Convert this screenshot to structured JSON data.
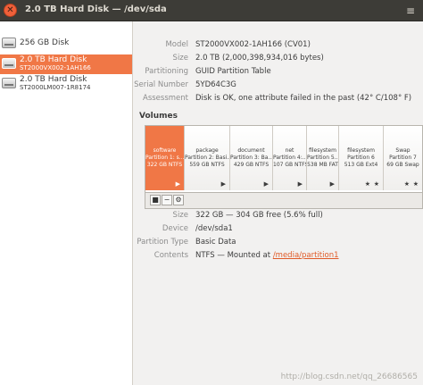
{
  "window": {
    "title": "2.0 TB Hard Disk — /dev/sda",
    "close_glyph": "✕",
    "menu_glyph": "≡"
  },
  "sidebar": {
    "disks": [
      {
        "name": "256 GB Disk",
        "model": ""
      },
      {
        "name": "2.0 TB Hard Disk",
        "model": "ST2000VX002-1AH166"
      },
      {
        "name": "2.0 TB Hard Disk",
        "model": "ST2000LM007-1R8174"
      }
    ]
  },
  "disk_info": {
    "model": {
      "label": "Model",
      "value": "ST2000VX002-1AH166 (CV01)"
    },
    "size": {
      "label": "Size",
      "value": "2.0 TB (2,000,398,934,016 bytes)"
    },
    "partitioning": {
      "label": "Partitioning",
      "value": "GUID Partition Table"
    },
    "serial": {
      "label": "Serial Number",
      "value": "5YD64C3G"
    },
    "assessment": {
      "label": "Assessment",
      "value": "Disk is OK, one attribute failed in the past (42° C/108° F)"
    }
  },
  "volumes": {
    "title": "Volumes",
    "partitions": [
      {
        "name": "software",
        "num": "Partition 1: s...",
        "size": "322 GB NTFS",
        "icon": "▶"
      },
      {
        "name": "package",
        "num": "Partition 2: Basi...",
        "size": "559 GB NTFS",
        "icon": "▶"
      },
      {
        "name": "document",
        "num": "Partition 3: Ba...",
        "size": "429 GB NTFS",
        "icon": "▶"
      },
      {
        "name": "net",
        "num": "Partition 4:...",
        "size": "107 GB NTFS",
        "icon": "▶"
      },
      {
        "name": "filesystem",
        "num": "Partition 5...",
        "size": "538 MB FAT",
        "icon": "▶"
      },
      {
        "name": "filesystem",
        "num": "Partition 6",
        "size": "513 GB Ext4",
        "icon": "★",
        "icon2": "★"
      },
      {
        "name": "Swap",
        "num": "Partition 7",
        "size": "69 GB Swap",
        "icon": "★",
        "icon2": "★"
      }
    ],
    "toolbar": {
      "stop_glyph": "■",
      "remove_glyph": "−",
      "settings_glyph": "⚙"
    }
  },
  "partition_info": {
    "size": {
      "label": "Size",
      "value": "322 GB — 304 GB free (5.6% full)"
    },
    "device": {
      "label": "Device",
      "value": "/dev/sda1"
    },
    "type": {
      "label": "Partition Type",
      "value": "Basic Data"
    },
    "contents": {
      "label": "Contents",
      "value_prefix": "NTFS — Mounted at ",
      "link": "/media/partition1"
    }
  },
  "watermark": "http://blog.csdn.net/qq_26686565",
  "colors": {
    "accent": "#f07746",
    "titlebar": "#3d3c37",
    "link": "#e05a27"
  }
}
